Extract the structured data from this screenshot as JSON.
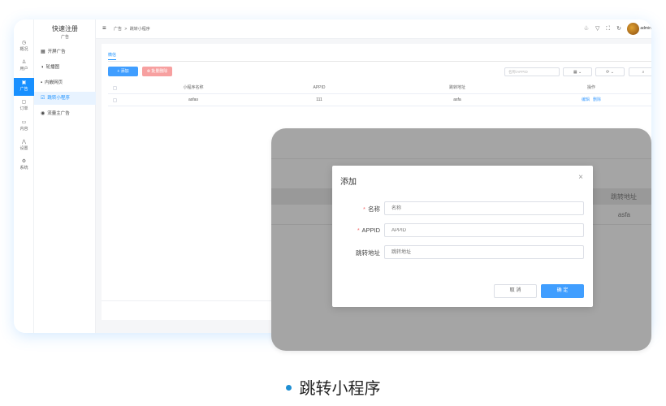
{
  "app": {
    "brand": "快速注册",
    "brand_sub": "广告",
    "rail": [
      {
        "icon": "◷",
        "label": "概况"
      },
      {
        "icon": "♙",
        "label": "用户"
      },
      {
        "icon": "▣",
        "label": "广告"
      },
      {
        "icon": "▢",
        "label": "订单"
      },
      {
        "icon": "▭",
        "label": "内容"
      },
      {
        "icon": "⋀",
        "label": "设置"
      },
      {
        "icon": "⚙",
        "label": "系统"
      }
    ],
    "subnav": [
      {
        "icon": "▦",
        "label": "开屏广告"
      },
      {
        "icon": "◑",
        "label": "轮播图"
      },
      {
        "icon": "▪",
        "label": "内嵌网页"
      },
      {
        "icon": "☑",
        "label": "跳转小程序"
      },
      {
        "icon": "◉",
        "label": "流量主广告"
      }
    ]
  },
  "topbar": {
    "menu_icon": "≡",
    "crumbs": [
      "广告",
      ">",
      "跳转小程序"
    ],
    "icons": "♧ ▽ ⛶ ↻",
    "user": "admin"
  },
  "content": {
    "tab": "微信",
    "add_label": "+ 添加",
    "batch_delete_label": "⊗ 批量删除",
    "search_placeholder": "名称/APPID",
    "tool1": "▦ ⌄",
    "tool2": "⟳ ⌄",
    "tool3": "⌕",
    "columns": [
      "小程序名称",
      "APPID",
      "跳转地址",
      "操作"
    ],
    "rows": [
      {
        "name": "asfas",
        "appid": "111",
        "url": "asfa",
        "edit": "编辑",
        "delete": "删除"
      }
    ]
  },
  "overlay_bg": {
    "ghost_header": "跳转地址",
    "ghost_cell": "asfa"
  },
  "modal": {
    "title": "添加",
    "close": "×",
    "fields": [
      {
        "label": "名称",
        "required": "*",
        "placeholder": "名称"
      },
      {
        "label": "APPID",
        "required": "*",
        "placeholder": "APPID"
      },
      {
        "label": "跳转地址",
        "required": "",
        "placeholder": "跳转地址"
      }
    ],
    "cancel": "取 消",
    "ok": "确 定"
  },
  "caption": "跳转小程序",
  "colors": {
    "accent": "#409eff",
    "danger": "#f56c6c",
    "rail_active": "#1890ff"
  }
}
